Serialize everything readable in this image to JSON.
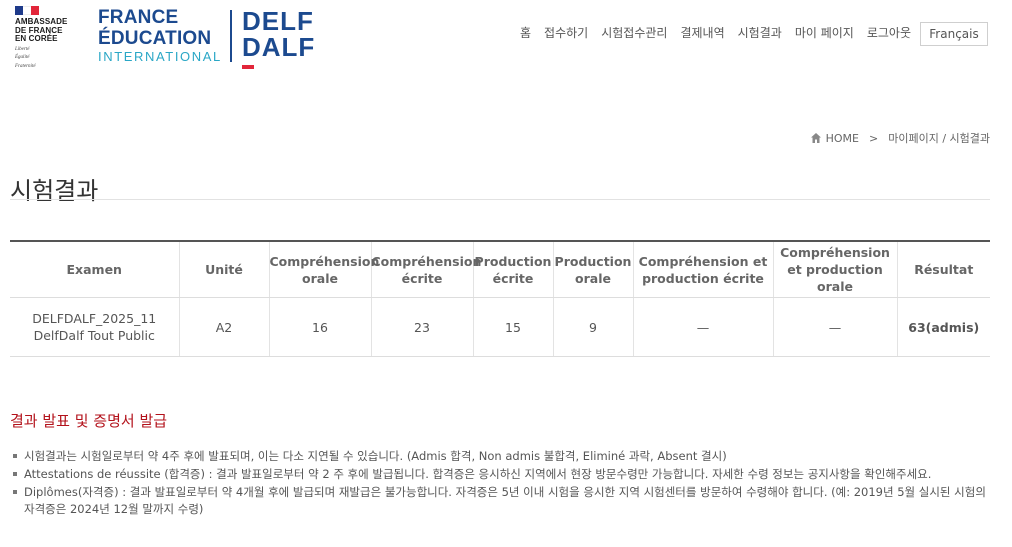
{
  "brand": {
    "ambassade_lines": [
      "AMBASSADE",
      "DE FRANCE",
      "EN CORÉE"
    ],
    "ambassade_motto": [
      "Liberté",
      "Égalité",
      "Fraternité"
    ],
    "flag_colors": [
      "#1e3a8a",
      "#ffffff",
      "#e2263a"
    ],
    "fei_line1": "FRANCE",
    "fei_line2": "ÉDUCATION",
    "fei_line3": "INTERNATIONAL",
    "delf_line1": "DELF",
    "delf_line2": "DALF",
    "accent_blue": "#1c4a8f",
    "accent_red": "#e2263a"
  },
  "nav": {
    "items": [
      "홈",
      "접수하기",
      "시험접수관리",
      "결제내역",
      "시험결과",
      "마이 페이지",
      "로그아웃"
    ],
    "language_button": "Français"
  },
  "breadcrumb": {
    "home": "HOME",
    "separator": ">",
    "path": "마이페이지 / 시험결과"
  },
  "page_title": "시험결과",
  "table": {
    "headers": [
      "Examen",
      "Unité",
      "Compréhension orale",
      "Compréhension écrite",
      "Production écrite",
      "Production orale",
      "Compréhension et production écrite",
      "Compréhension et production orale",
      "Résultat"
    ],
    "rows": [
      {
        "exam_line1": "DELFDALF_2025_11",
        "exam_line2": "DelfDalf Tout Public",
        "unite": "A2",
        "co": "16",
        "ce": "23",
        "pe": "15",
        "po": "9",
        "cpe": "—",
        "cpo": "—",
        "result": "63(admis)"
      }
    ]
  },
  "notice": {
    "title": "결과 발표 및 증명서 발급",
    "items": [
      "시험결과는 시험일로부터 약 4주 후에 발표되며, 이는 다소 지연될 수 있습니다. (Admis 합격, Non admis 불합격, Eliminé 과락, Absent 결시)",
      "Attestations de réussite (합격증) : 결과 발표일로부터 약 2 주 후에 발급됩니다. 합격증은 응시하신 지역에서 현장 방문수령만 가능합니다. 자세한 수령 정보는 공지사항을 확인해주세요.",
      "Diplômes(자격증) : 결과 발표일로부터 약 4개월 후에 발급되며 재발급은 불가능합니다. 자격증은 5년 이내 시험을 응시한 지역 시험센터를 방문하여 수령해야 합니다. (예: 2019년 5월 실시된 시험의 자격증은 2024년 12월 말까지 수령)"
    ]
  }
}
